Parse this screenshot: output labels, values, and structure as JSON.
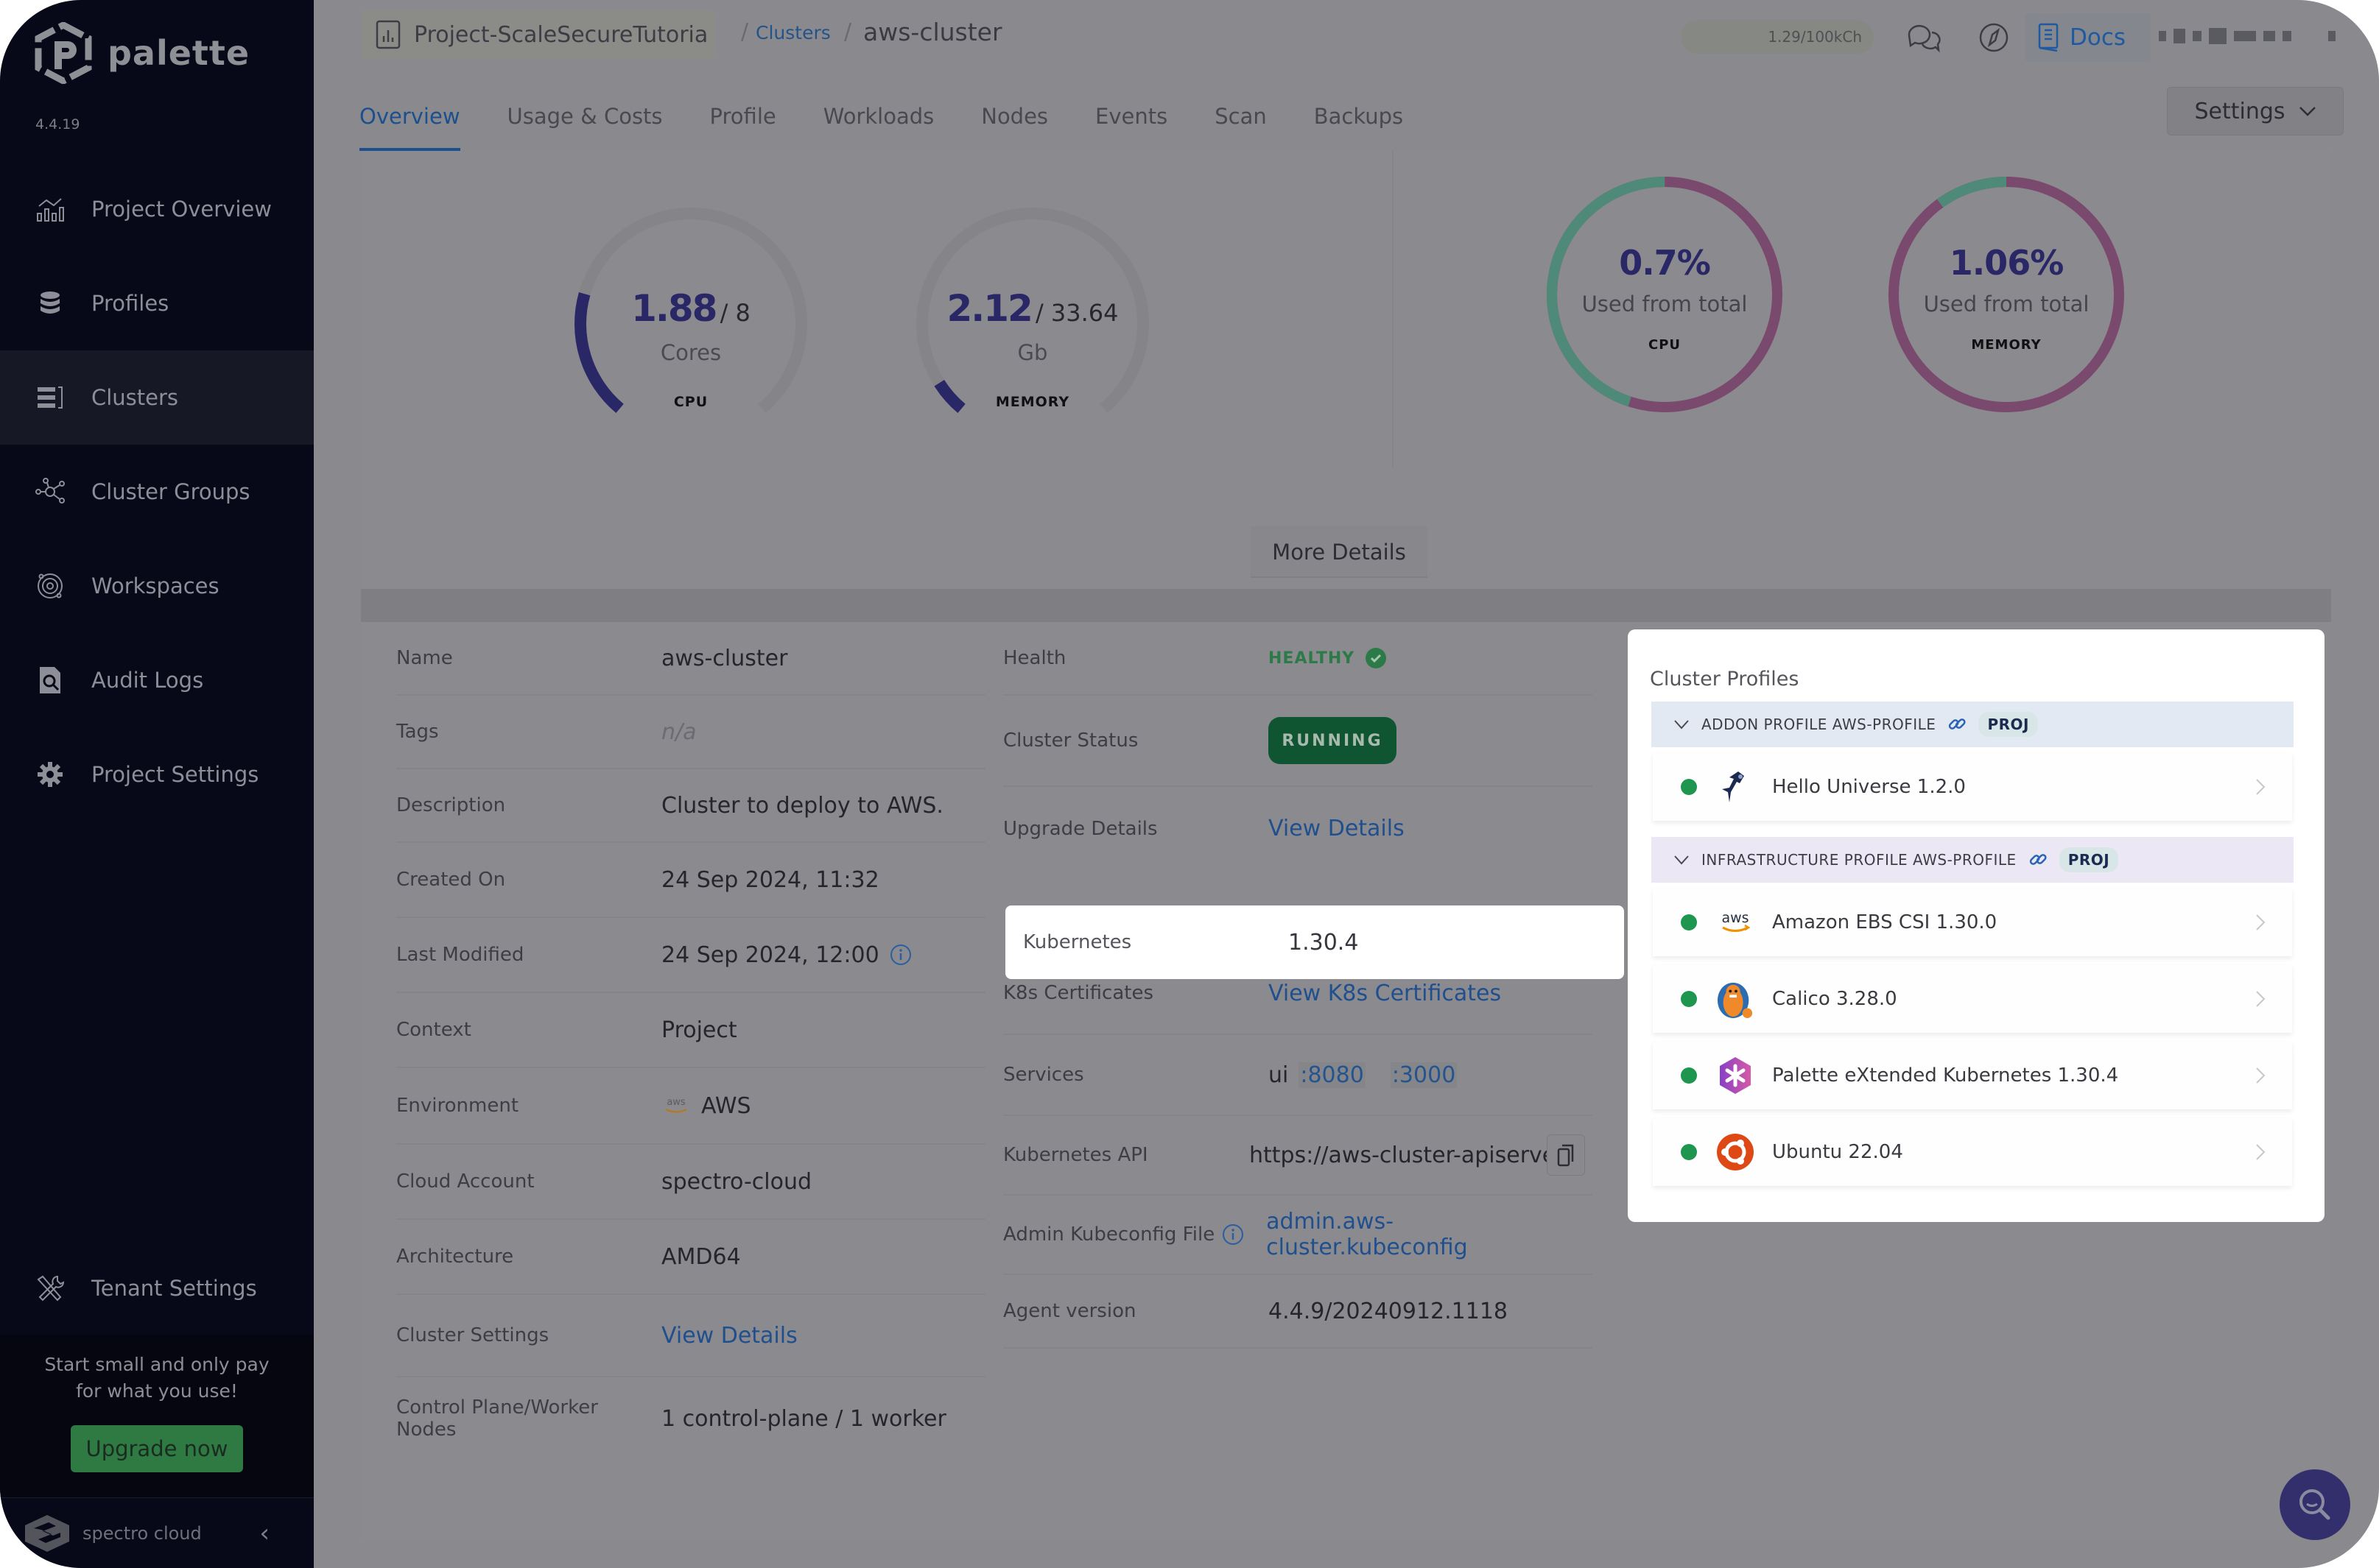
{
  "app": {
    "name": "palette",
    "version": "4.4.19"
  },
  "sidebar": {
    "items": [
      {
        "label": "Project Overview",
        "icon": "chart-icon"
      },
      {
        "label": "Profiles",
        "icon": "stack-icon"
      },
      {
        "label": "Clusters",
        "icon": "clusters-icon",
        "active": true
      },
      {
        "label": "Cluster Groups",
        "icon": "network-icon"
      },
      {
        "label": "Workspaces",
        "icon": "workspace-icon"
      },
      {
        "label": "Audit Logs",
        "icon": "audit-log-icon"
      },
      {
        "label": "Project Settings",
        "icon": "gear-icon"
      }
    ],
    "tenant_settings": "Tenant Settings",
    "promo_line1": "Start small and only pay",
    "promo_line2": "for what you use!",
    "upgrade_label": "Upgrade now",
    "footer_brand": "spectro cloud"
  },
  "topbar": {
    "project": "Project-ScaleSecureTutoria",
    "breadcrumb_sep": "/",
    "breadcrumb_clusters": "Clusters",
    "breadcrumb_current": "aws-cluster",
    "credits": "1.29/100kCh",
    "docs_label": "Docs"
  },
  "tabs": [
    {
      "label": "Overview",
      "active": true
    },
    {
      "label": "Usage & Costs"
    },
    {
      "label": "Profile"
    },
    {
      "label": "Workloads"
    },
    {
      "label": "Nodes"
    },
    {
      "label": "Events"
    },
    {
      "label": "Scan"
    },
    {
      "label": "Backups"
    }
  ],
  "settings_button": "Settings",
  "usage": {
    "cpu": {
      "value": "1.88",
      "total": "/ 8",
      "unit": "Cores",
      "label": "CPU",
      "fraction": 0.235
    },
    "memory": {
      "value": "2.12",
      "total": "/ 33.64",
      "unit": "Gb",
      "label": "MEMORY",
      "fraction": 0.063
    },
    "cpu_total": {
      "percent": "0.7%",
      "sub": "Used from total",
      "label": "CPU",
      "green_fraction": 0.45
    },
    "memory_total": {
      "percent": "1.06%",
      "sub": "Used from total",
      "label": "MEMORY",
      "green_fraction": 0.1
    },
    "more_details": "More Details",
    "colors": {
      "gauge_fill": "#2a2766",
      "donut_green": "#4f8a78",
      "donut_purple": "#7a4a6e"
    }
  },
  "details_left": [
    {
      "label": "Name",
      "value": "aws-cluster"
    },
    {
      "label": "Tags",
      "value": "n/a",
      "muted": true
    },
    {
      "label": "Description",
      "value": "Cluster to deploy to AWS."
    },
    {
      "label": "Created On",
      "value": "24 Sep 2024, 11:32"
    },
    {
      "label": "Last Modified",
      "value": "24 Sep 2024, 12:00",
      "info": true
    },
    {
      "label": "Context",
      "value": "Project"
    },
    {
      "label": "Environment",
      "value": "AWS",
      "icon": "aws-icon"
    },
    {
      "label": "Cloud Account",
      "value": "spectro-cloud"
    },
    {
      "label": "Architecture",
      "value": "AMD64"
    },
    {
      "label": "Cluster Settings",
      "value": "View Details",
      "link": true
    },
    {
      "label": "Control Plane/Worker Nodes",
      "value": "1 control-plane / 1 worker"
    }
  ],
  "details_right": {
    "health_label": "Health",
    "health_value": "HEALTHY",
    "status_label": "Cluster Status",
    "status_value": "RUNNING",
    "upgrade_label": "Upgrade Details",
    "upgrade_value": "View Details",
    "kubernetes_label": "Kubernetes",
    "kubernetes_value": "1.30.4",
    "certs_label": "K8s Certificates",
    "certs_value": "View K8s Certificates",
    "services_label": "Services",
    "services_name": "ui",
    "services_port1": ":8080",
    "services_port2": ":3000",
    "api_label": "Kubernetes API",
    "api_value": "https://aws-cluster-apiserve...",
    "kubeconfig_label": "Admin Kubeconfig File",
    "kubeconfig_value": "admin.aws-cluster.kubeconfig",
    "agent_label": "Agent version",
    "agent_value": "4.4.9/20240912.1118"
  },
  "cluster_profiles": {
    "title": "Cluster Profiles",
    "groups": [
      {
        "name": "ADDON PROFILE AWS-PROFILE",
        "badge": "PROJ",
        "layers": [
          {
            "name": "Hello Universe 1.2.0",
            "icon": "hello-universe-icon"
          }
        ]
      },
      {
        "name": "INFRASTRUCTURE PROFILE AWS-PROFILE",
        "badge": "PROJ",
        "layers": [
          {
            "name": "Amazon EBS CSI 1.30.0",
            "icon": "aws-icon"
          },
          {
            "name": "Calico 3.28.0",
            "icon": "calico-icon"
          },
          {
            "name": "Palette eXtended Kubernetes 1.30.4",
            "icon": "pxk-icon"
          },
          {
            "name": "Ubuntu 22.04",
            "icon": "ubuntu-icon"
          }
        ]
      }
    ]
  }
}
